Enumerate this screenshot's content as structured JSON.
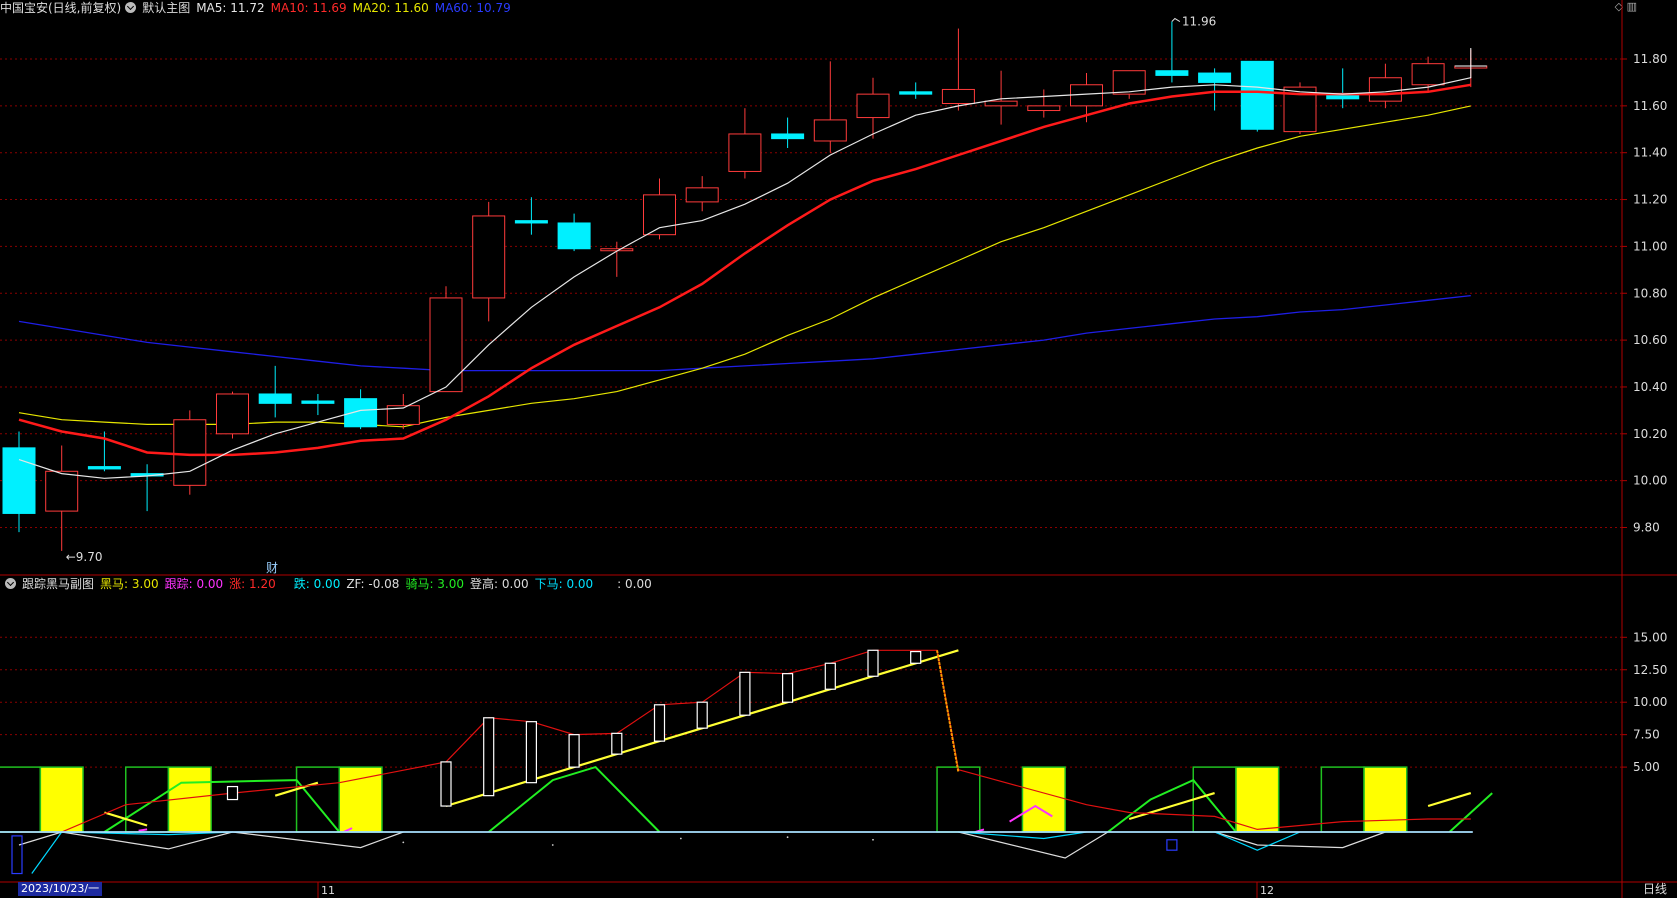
{
  "main_header": {
    "symbol": "中国宝安(日线,前复权)",
    "template": "默认主图",
    "ma5": "MA5: 11.72",
    "ma10": "MA10: 11.69",
    "ma20": "MA20: 11.60",
    "ma60": "MA60: 10.79"
  },
  "top_icons": "◇ ▥",
  "sub_header": {
    "name": "跟踪黑马副图",
    "heima": "黑马: 3.00",
    "genzong": "跟踪: 0.00",
    "zhang": "涨: 1.20",
    "die": "跌: 0.00",
    "zf": "ZF: -0.08",
    "qima": "骑马: 3.00",
    "denggao": "登高: 0.00",
    "xiama": "下马: 0.00",
    "blank": ": 0.00"
  },
  "footer": {
    "date": "2023/10/23/一",
    "period": "日线",
    "month_nov": "11",
    "month_dec": "12"
  },
  "annotations": {
    "low": "9.70",
    "high": "11.96",
    "fin": "财"
  },
  "colors": {
    "up": "#ff3b3b",
    "down": "#00f0ff",
    "ma5": "#e6e6e6",
    "ma10": "#ff1a1a",
    "ma20": "#e6e600",
    "ma60": "#1e1ee6",
    "grid": "#8b0000"
  },
  "chart_data": [
    {
      "type": "candlestick",
      "y_ticks": [
        "11.80",
        "11.60",
        "11.40",
        "11.20",
        "11.00",
        "10.80",
        "10.60",
        "10.40",
        "10.20",
        "10.00",
        "9.80"
      ],
      "ylim": [
        9.6,
        12.05
      ],
      "candles": [
        {
          "o": 10.14,
          "h": 10.21,
          "l": 9.78,
          "c": 9.86
        },
        {
          "o": 9.87,
          "h": 10.15,
          "l": 9.7,
          "c": 10.04
        },
        {
          "o": 10.06,
          "h": 10.21,
          "l": 10.04,
          "c": 10.05
        },
        {
          "o": 10.03,
          "h": 10.07,
          "l": 9.87,
          "c": 10.02
        },
        {
          "o": 9.98,
          "h": 10.3,
          "l": 9.94,
          "c": 10.26
        },
        {
          "o": 10.2,
          "h": 10.38,
          "l": 10.18,
          "c": 10.37
        },
        {
          "o": 10.37,
          "h": 10.49,
          "l": 10.27,
          "c": 10.33
        },
        {
          "o": 10.34,
          "h": 10.37,
          "l": 10.28,
          "c": 10.33
        },
        {
          "o": 10.35,
          "h": 10.39,
          "l": 10.22,
          "c": 10.23
        },
        {
          "o": 10.24,
          "h": 10.37,
          "l": 10.22,
          "c": 10.32
        },
        {
          "o": 10.38,
          "h": 10.83,
          "l": 10.38,
          "c": 10.78
        },
        {
          "o": 10.78,
          "h": 11.19,
          "l": 10.68,
          "c": 11.13
        },
        {
          "o": 11.11,
          "h": 11.21,
          "l": 11.05,
          "c": 11.1
        },
        {
          "o": 11.1,
          "h": 11.14,
          "l": 10.98,
          "c": 10.99
        },
        {
          "o": 10.99,
          "h": 11.02,
          "l": 10.87,
          "c": 10.99
        },
        {
          "o": 11.05,
          "h": 11.29,
          "l": 11.03,
          "c": 11.22
        },
        {
          "o": 11.19,
          "h": 11.3,
          "l": 11.15,
          "c": 11.25
        },
        {
          "o": 11.32,
          "h": 11.59,
          "l": 11.29,
          "c": 11.48
        },
        {
          "o": 11.48,
          "h": 11.55,
          "l": 11.42,
          "c": 11.46
        },
        {
          "o": 11.45,
          "h": 11.79,
          "l": 11.4,
          "c": 11.54
        },
        {
          "o": 11.55,
          "h": 11.72,
          "l": 11.46,
          "c": 11.65
        },
        {
          "o": 11.66,
          "h": 11.7,
          "l": 11.63,
          "c": 11.65
        },
        {
          "o": 11.61,
          "h": 11.93,
          "l": 11.58,
          "c": 11.67
        },
        {
          "o": 11.6,
          "h": 11.75,
          "l": 11.52,
          "c": 11.62
        },
        {
          "o": 11.58,
          "h": 11.67,
          "l": 11.55,
          "c": 11.6
        },
        {
          "o": 11.6,
          "h": 11.74,
          "l": 11.53,
          "c": 11.69
        },
        {
          "o": 11.65,
          "h": 11.75,
          "l": 11.63,
          "c": 11.75
        },
        {
          "o": 11.75,
          "h": 11.96,
          "l": 11.7,
          "c": 11.73
        },
        {
          "o": 11.74,
          "h": 11.76,
          "l": 11.58,
          "c": 11.7
        },
        {
          "o": 11.79,
          "h": 11.79,
          "l": 11.49,
          "c": 11.5
        },
        {
          "o": 11.49,
          "h": 11.7,
          "l": 11.48,
          "c": 11.68
        },
        {
          "o": 11.65,
          "h": 11.76,
          "l": 11.59,
          "c": 11.63
        },
        {
          "o": 11.62,
          "h": 11.78,
          "l": 11.59,
          "c": 11.72
        },
        {
          "o": 11.69,
          "h": 11.81,
          "l": 11.66,
          "c": 11.78
        },
        {
          "o": 11.77,
          "h": 11.84,
          "l": 11.68,
          "c": 11.77
        }
      ],
      "ma5": [
        10.09,
        10.03,
        10.01,
        10.02,
        10.04,
        10.13,
        10.2,
        10.25,
        10.3,
        10.31,
        10.4,
        10.58,
        10.74,
        10.87,
        10.98,
        11.08,
        11.11,
        11.18,
        11.27,
        11.39,
        11.48,
        11.56,
        11.6,
        11.63,
        11.64,
        11.65,
        11.66,
        11.68,
        11.69,
        11.68,
        11.66,
        11.65,
        11.66,
        11.68,
        11.72
      ],
      "ma10": [
        10.26,
        10.21,
        10.18,
        10.12,
        10.11,
        10.11,
        10.12,
        10.14,
        10.17,
        10.18,
        10.26,
        10.36,
        10.48,
        10.58,
        10.66,
        10.74,
        10.84,
        10.97,
        11.09,
        11.2,
        11.28,
        11.33,
        11.39,
        11.45,
        11.51,
        11.56,
        11.61,
        11.64,
        11.66,
        11.66,
        11.65,
        11.65,
        11.65,
        11.66,
        11.69
      ],
      "ma20": [
        10.29,
        10.26,
        10.25,
        10.24,
        10.24,
        10.24,
        10.25,
        10.25,
        10.24,
        10.23,
        10.27,
        10.3,
        10.33,
        10.35,
        10.38,
        10.43,
        10.48,
        10.54,
        10.62,
        10.69,
        10.78,
        10.86,
        10.94,
        11.02,
        11.08,
        11.15,
        11.22,
        11.29,
        11.36,
        11.42,
        11.47,
        11.5,
        11.53,
        11.56,
        11.6
      ],
      "ma60": [
        10.68,
        10.65,
        10.62,
        10.59,
        10.57,
        10.55,
        10.53,
        10.51,
        10.49,
        10.48,
        10.47,
        10.47,
        10.47,
        10.47,
        10.47,
        10.47,
        10.48,
        10.49,
        10.5,
        10.51,
        10.52,
        10.54,
        10.56,
        10.58,
        10.6,
        10.63,
        10.65,
        10.67,
        10.69,
        10.7,
        10.72,
        10.73,
        10.75,
        10.77,
        10.79
      ]
    },
    {
      "type": "indicator",
      "y_ticks": [
        "15.00",
        "12.50",
        "10.00",
        "7.50",
        "5.00"
      ],
      "ylim": [
        -3.5,
        16.5
      ],
      "heima_bars": [
        0,
        1,
        3,
        4,
        7,
        8,
        22,
        24,
        28,
        29,
        31,
        32
      ],
      "zhang_bars": [
        [
          5,
          2.5,
          3.5
        ],
        [
          10,
          2,
          5.4
        ],
        [
          11,
          2.8,
          8.8
        ],
        [
          12,
          3.8,
          8.5
        ],
        [
          13,
          5,
          7.5
        ],
        [
          14,
          6,
          7.6
        ],
        [
          15,
          7,
          9.8
        ],
        [
          16,
          8,
          10.0
        ],
        [
          17,
          9,
          12.3
        ],
        [
          18,
          10,
          12.2
        ],
        [
          19,
          11,
          13.0
        ],
        [
          20,
          12,
          14.0
        ],
        [
          21,
          13,
          13.9
        ]
      ],
      "qima": [
        null,
        null,
        1.5,
        0.5,
        null,
        null,
        2.8,
        3.8,
        null,
        null,
        2,
        3,
        4,
        5,
        6,
        7,
        8,
        9,
        10,
        11,
        12,
        13,
        14,
        null,
        null,
        null,
        1,
        2,
        3,
        null,
        null,
        null,
        null,
        2,
        3
      ],
      "green_up": [
        [
          [
            2,
            0
          ],
          [
            3.8,
            3.8
          ],
          [
            6.5,
            4
          ],
          [
            7.5,
            0
          ]
        ],
        [
          [
            11,
            0
          ],
          [
            12.5,
            4
          ],
          [
            13.5,
            5
          ],
          [
            15,
            0
          ]
        ],
        [
          [
            25.5,
            0
          ],
          [
            26.5,
            2.5
          ],
          [
            27.5,
            4
          ],
          [
            28.5,
            0
          ]
        ],
        [
          [
            33.5,
            0
          ],
          [
            34.5,
            3
          ]
        ]
      ],
      "white_lower": [
        [
          [
            0,
            -1
          ],
          [
            1,
            0
          ],
          [
            3.5,
            -1.3
          ],
          [
            5,
            0
          ],
          [
            8,
            -1.2
          ],
          [
            9,
            0
          ]
        ],
        [
          [
            22,
            0
          ],
          [
            24.5,
            -2
          ],
          [
            25.5,
            0
          ]
        ],
        [
          [
            28,
            0
          ],
          [
            29,
            -1
          ],
          [
            31,
            -1.2
          ],
          [
            32,
            0
          ]
        ]
      ],
      "cyan_lower": [
        [
          [
            0.3,
            -3.2
          ],
          [
            1,
            0
          ],
          [
            3.5,
            -0.2
          ],
          [
            5,
            0
          ]
        ],
        [
          [
            22,
            0
          ],
          [
            24,
            -0.5
          ],
          [
            25,
            0
          ]
        ],
        [
          [
            28,
            0
          ],
          [
            29,
            -1.4
          ],
          [
            30,
            0
          ]
        ]
      ],
      "red_line": [
        [
          0,
          0
        ],
        [
          1,
          0
        ],
        [
          2.5,
          2.1
        ],
        [
          5,
          3
        ],
        [
          7.5,
          3.8
        ],
        [
          10,
          5.4
        ],
        [
          11,
          8.8
        ],
        [
          12,
          8.5
        ],
        [
          13,
          7.5
        ],
        [
          14,
          7.6
        ],
        [
          15,
          9.8
        ],
        [
          16,
          10.0
        ],
        [
          17,
          12.3
        ],
        [
          18,
          12.2
        ],
        [
          19,
          13.0
        ],
        [
          20,
          14.0
        ],
        [
          21.5,
          14
        ],
        [
          22,
          4.8
        ],
        [
          25,
          2.1
        ],
        [
          26,
          1.5
        ],
        [
          28,
          1.2
        ],
        [
          29,
          0.2
        ],
        [
          31,
          0.8
        ],
        [
          33,
          1
        ],
        [
          34,
          1
        ]
      ],
      "magenta": [
        [
          [
            2.8,
            0.1
          ],
          [
            3,
            0.2
          ]
        ],
        [
          [
            7.6,
            0
          ],
          [
            7.8,
            0.3
          ]
        ],
        [
          [
            22.4,
            0
          ],
          [
            22.6,
            0.2
          ]
        ],
        [
          [
            23.2,
            0.8
          ],
          [
            23.8,
            2
          ],
          [
            24.2,
            1.2
          ]
        ]
      ],
      "orange_drop": [
        [
          21.5,
          14
        ],
        [
          22,
          4.6
        ]
      ]
    }
  ]
}
